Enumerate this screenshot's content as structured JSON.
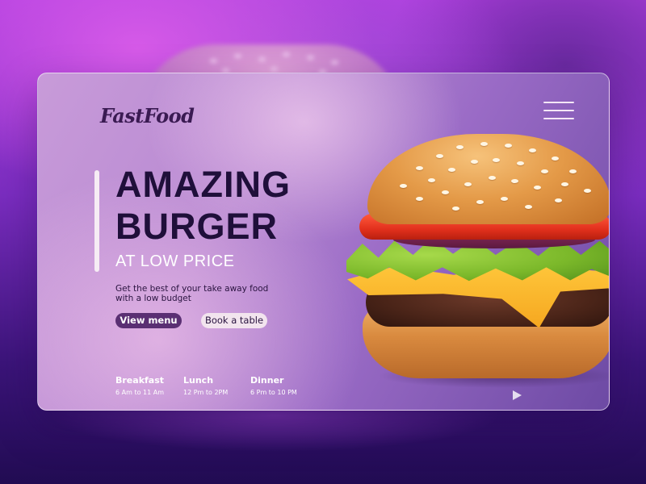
{
  "brand": {
    "logo_text": "FastFood"
  },
  "hero": {
    "headline_line1": "AMAZING",
    "headline_line2": "BURGER",
    "subheadline": "AT LOW PRICE",
    "description": "Get the best of your take away food with a low budget"
  },
  "buttons": {
    "view_menu": "View menu",
    "book_table": "Book a table"
  },
  "hours": [
    {
      "name": "Breakfast",
      "time": "6 Am to 11 Am"
    },
    {
      "name": "Lunch",
      "time": "12 Pm to 2PM"
    },
    {
      "name": "Dinner",
      "time": "6 Pm to 10 PM"
    }
  ],
  "icons": {
    "menu": "hamburger-menu-icon",
    "play": "play-icon"
  },
  "colors": {
    "background": "#7b2dc0",
    "card": "#b889d2",
    "headline": "#1f0f3a",
    "primary_button": "#5a2f73",
    "secondary_button": "#f2e4ee",
    "accent_bar": "#f6ecf4"
  }
}
